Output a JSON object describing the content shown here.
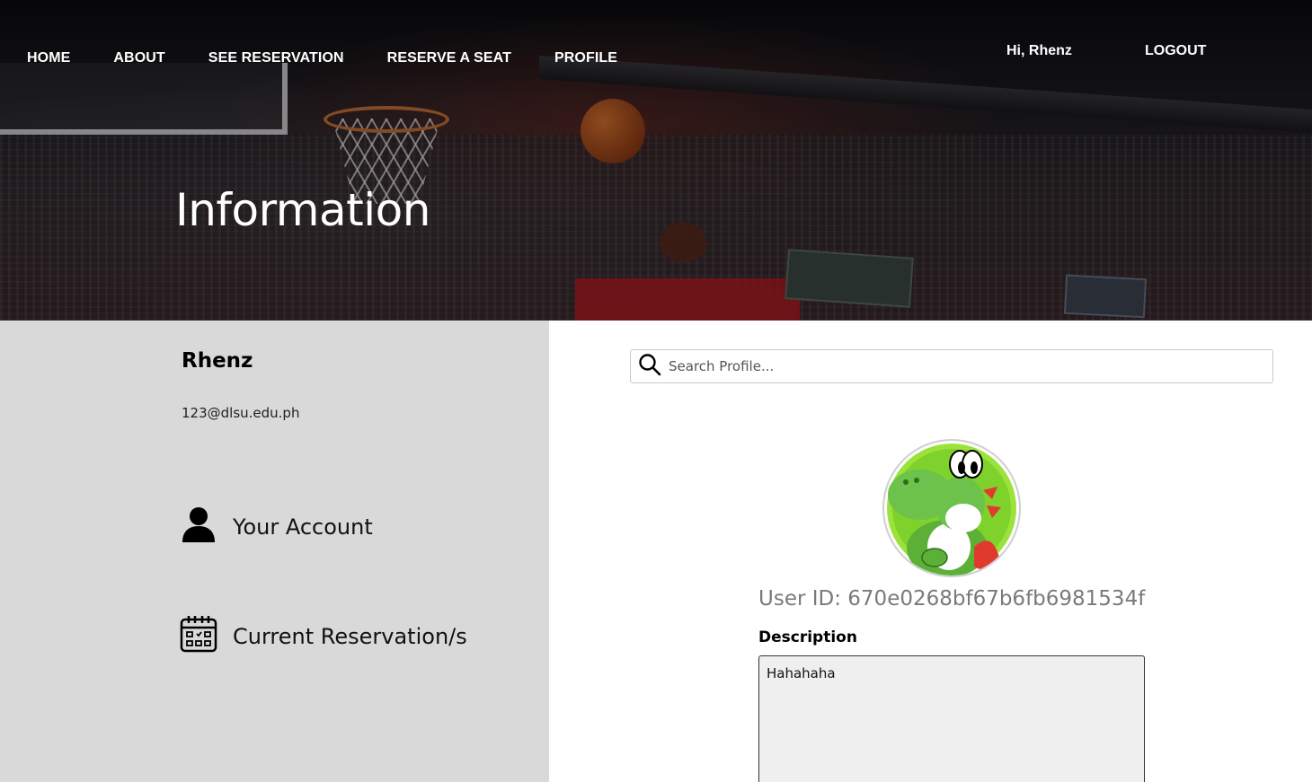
{
  "nav": {
    "items": [
      {
        "label": "HOME"
      },
      {
        "label": "ABOUT"
      },
      {
        "label": "SEE RESERVATION"
      },
      {
        "label": "RESERVE A SEAT"
      },
      {
        "label": "PROFILE"
      }
    ],
    "greeting": "Hi, Rhenz",
    "logout_label": "LOGOUT"
  },
  "hero": {
    "title": "Information"
  },
  "sidebar": {
    "name": "Rhenz",
    "email": "123@dlsu.edu.ph",
    "items": [
      {
        "label": "Your Account",
        "icon": "person-icon"
      },
      {
        "label": "Current Reservation/s",
        "icon": "calendar-icon"
      }
    ]
  },
  "search": {
    "placeholder": "Search Profile..."
  },
  "profile": {
    "avatar_icon": "yoshi-avatar",
    "user_id": "User ID: 670e0268bf67b6fb6981534f",
    "description_label": "Description",
    "description_value": "Hahahaha"
  },
  "colors": {
    "sidebar_bg": "#d9d9d9",
    "description_bg": "#efefef",
    "user_id_text": "#7a7a7a"
  }
}
